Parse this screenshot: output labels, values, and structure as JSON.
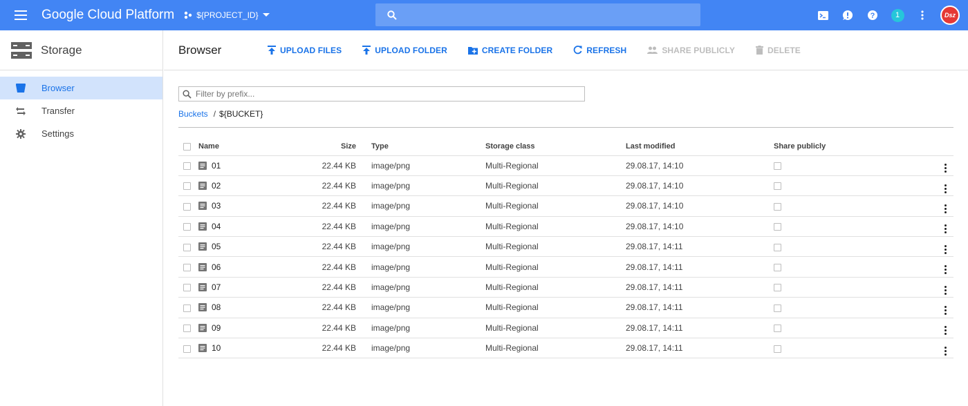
{
  "colors": {
    "topbar": "#4285f4",
    "accent": "#1a73e8",
    "active_bg": "#d2e3fc"
  },
  "topbar": {
    "brand": "Google Cloud Platform",
    "project": "${PROJECT_ID}",
    "search_placeholder": "",
    "notification_count": "1",
    "avatar_text": "Dsz",
    "icons": [
      "cloud-shell-icon",
      "feedback-icon",
      "help-icon",
      "notifications-icon",
      "more-vert-icon",
      "avatar"
    ]
  },
  "sidebar": {
    "title": "Storage",
    "items": [
      {
        "label": "Browser",
        "icon": "bucket-icon",
        "active": true
      },
      {
        "label": "Transfer",
        "icon": "transfer-icon",
        "active": false
      },
      {
        "label": "Settings",
        "icon": "gear-icon",
        "active": false
      }
    ]
  },
  "toolbar": {
    "title": "Browser",
    "upload_files": "UPLOAD FILES",
    "upload_folder": "UPLOAD FOLDER",
    "create_folder": "CREATE FOLDER",
    "refresh": "REFRESH",
    "share_publicly": "SHARE PUBLICLY",
    "delete": "DELETE"
  },
  "filter": {
    "placeholder": "Filter by prefix..."
  },
  "breadcrumb": {
    "root": "Buckets",
    "separator": "/",
    "current": "${BUCKET}"
  },
  "table": {
    "headers": {
      "name": "Name",
      "size": "Size",
      "type": "Type",
      "storage_class": "Storage class",
      "last_modified": "Last modified",
      "share": "Share publicly"
    },
    "rows": [
      {
        "name": "01",
        "size": "22.44 KB",
        "type": "image/png",
        "storage_class": "Multi-Regional",
        "last_modified": "29.08.17, 14:10"
      },
      {
        "name": "02",
        "size": "22.44 KB",
        "type": "image/png",
        "storage_class": "Multi-Regional",
        "last_modified": "29.08.17, 14:10"
      },
      {
        "name": "03",
        "size": "22.44 KB",
        "type": "image/png",
        "storage_class": "Multi-Regional",
        "last_modified": "29.08.17, 14:10"
      },
      {
        "name": "04",
        "size": "22.44 KB",
        "type": "image/png",
        "storage_class": "Multi-Regional",
        "last_modified": "29.08.17, 14:10"
      },
      {
        "name": "05",
        "size": "22.44 KB",
        "type": "image/png",
        "storage_class": "Multi-Regional",
        "last_modified": "29.08.17, 14:11"
      },
      {
        "name": "06",
        "size": "22.44 KB",
        "type": "image/png",
        "storage_class": "Multi-Regional",
        "last_modified": "29.08.17, 14:11"
      },
      {
        "name": "07",
        "size": "22.44 KB",
        "type": "image/png",
        "storage_class": "Multi-Regional",
        "last_modified": "29.08.17, 14:11"
      },
      {
        "name": "08",
        "size": "22.44 KB",
        "type": "image/png",
        "storage_class": "Multi-Regional",
        "last_modified": "29.08.17, 14:11"
      },
      {
        "name": "09",
        "size": "22.44 KB",
        "type": "image/png",
        "storage_class": "Multi-Regional",
        "last_modified": "29.08.17, 14:11"
      },
      {
        "name": "10",
        "size": "22.44 KB",
        "type": "image/png",
        "storage_class": "Multi-Regional",
        "last_modified": "29.08.17, 14:11"
      }
    ]
  }
}
